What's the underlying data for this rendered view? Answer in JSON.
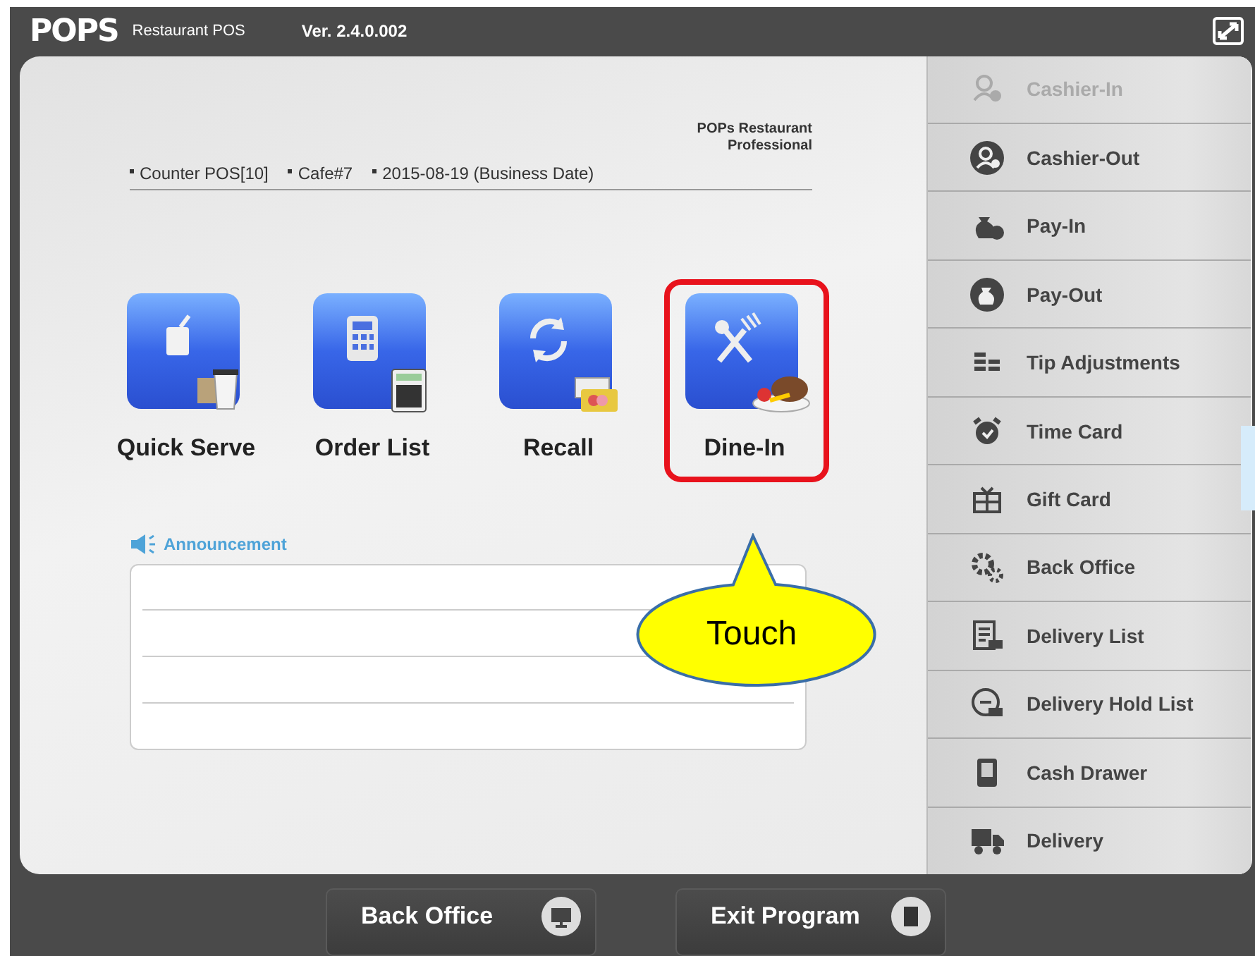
{
  "title_bar": {
    "brand": "POPS",
    "product": "Restaurant POS",
    "version": "Ver. 2.4.0.002"
  },
  "header": {
    "edition": "POPs Restaurant Professional",
    "info": [
      "Counter POS[10]",
      "Cafe#7",
      "2015-08-19 (Business Date)"
    ]
  },
  "tiles": [
    {
      "label": "Quick Serve",
      "highlighted": false
    },
    {
      "label": "Order List",
      "highlighted": false
    },
    {
      "label": "Recall",
      "highlighted": false
    },
    {
      "label": "Dine-In",
      "highlighted": true
    }
  ],
  "callout": {
    "text": "Touch"
  },
  "announcement": {
    "title": "Announcement"
  },
  "sidebar": {
    "items": [
      {
        "label": "Cashier-In",
        "disabled": true
      },
      {
        "label": "Cashier-Out",
        "disabled": false
      },
      {
        "label": "Pay-In",
        "disabled": false
      },
      {
        "label": "Pay-Out",
        "disabled": false
      },
      {
        "label": "Tip Adjustments",
        "disabled": false
      },
      {
        "label": "Time Card",
        "disabled": false
      },
      {
        "label": "Gift Card",
        "disabled": false
      },
      {
        "label": "Back Office",
        "disabled": false
      },
      {
        "label": "Delivery List",
        "disabled": false
      },
      {
        "label": "Delivery Hold List",
        "disabled": false
      },
      {
        "label": "Cash Drawer",
        "disabled": false
      },
      {
        "label": "Delivery",
        "disabled": false
      }
    ]
  },
  "bottom_buttons": [
    "Back Office",
    "Exit Program"
  ]
}
